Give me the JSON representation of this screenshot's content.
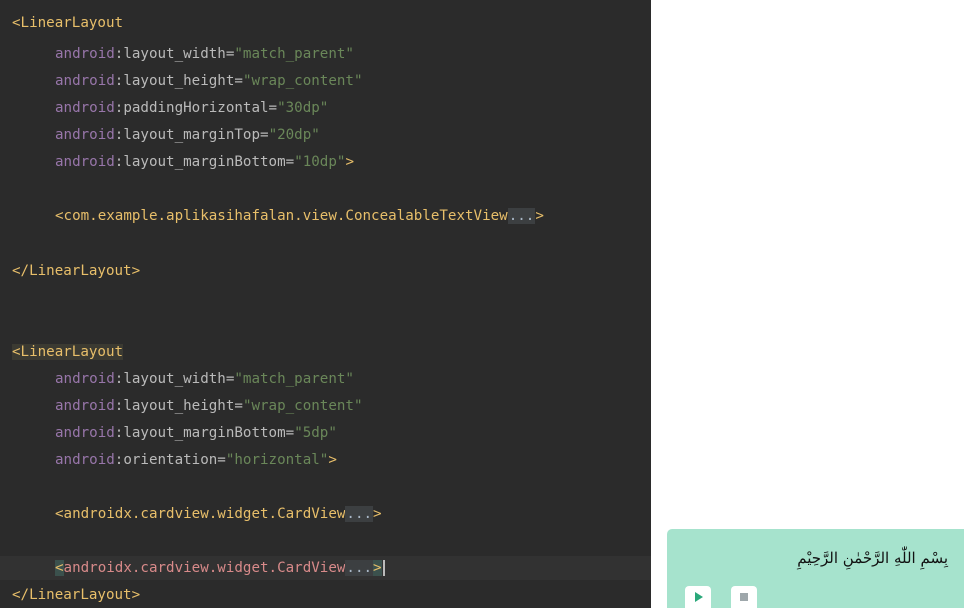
{
  "editor": {
    "block1": {
      "open_tag": "<LinearLayout",
      "attrs": [
        {
          "ns": "android",
          "name": ":layout_width",
          "eq": "=",
          "value": "\"match_parent\""
        },
        {
          "ns": "android",
          "name": ":layout_height",
          "eq": "=",
          "value": "\"wrap_content\""
        },
        {
          "ns": "android",
          "name": ":paddingHorizontal",
          "eq": "=",
          "value": "\"30dp\""
        },
        {
          "ns": "android",
          "name": ":layout_marginTop",
          "eq": "=",
          "value": "\"20dp\""
        },
        {
          "ns": "android",
          "name": ":layout_marginBottom",
          "eq": "=",
          "value": "\"10dp\"",
          "end": ">"
        }
      ],
      "child": "<com.example.aplikasihafalan.view.ConcealableTextView",
      "child_fold": "...",
      "child_end": ">",
      "close_tag": "</LinearLayout>"
    },
    "block2": {
      "open_lt": "<",
      "open_tag": "LinearLayout",
      "attrs": [
        {
          "ns": "android",
          "name": ":layout_width",
          "eq": "=",
          "value": "\"match_parent\""
        },
        {
          "ns": "android",
          "name": ":layout_height",
          "eq": "=",
          "value": "\"wrap_content\""
        },
        {
          "ns": "android",
          "name": ":layout_marginBottom",
          "eq": "=",
          "value": "\"5dp\""
        },
        {
          "ns": "android",
          "name": ":orientation",
          "eq": "=",
          "value": "\"horizontal\"",
          "end": ">"
        }
      ],
      "card1": "<androidx.cardview.widget.CardView",
      "card1_fold": "...",
      "card1_end": ">",
      "card2_lt": "<",
      "card2": "androidx.cardview.widget.CardView",
      "card2_fold": "...",
      "card2_end": ">",
      "close_tag": "</LinearLayout>"
    }
  },
  "preview": {
    "ayah_text": "بِسْمِ اللّٰهِ الرَّحْمٰنِ الرَّحِيْمِ",
    "play_icon": "play-icon",
    "stop_icon": "stop-icon",
    "background_color": "#a6e3cd"
  }
}
